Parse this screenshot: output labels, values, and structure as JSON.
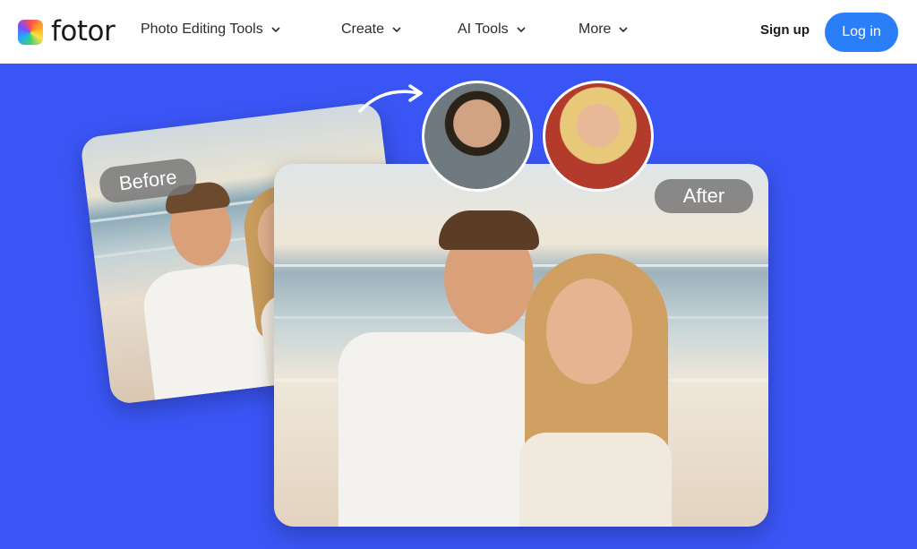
{
  "brand": {
    "name": "fotor"
  },
  "nav": {
    "items": [
      {
        "label": "Photo Editing Tools"
      },
      {
        "label": "Create"
      },
      {
        "label": "AI Tools"
      },
      {
        "label": "More"
      }
    ],
    "signup": "Sign up",
    "login": "Log in"
  },
  "hero": {
    "before_label": "Before",
    "after_label": "After"
  },
  "colors": {
    "hero_bg": "#3a55f5",
    "login_bg": "#2a7ef7",
    "nav_bg": "#ffffff"
  },
  "icons": [
    "fotor-logo-icon",
    "chevron-down-icon",
    "curved-arrow-icon"
  ]
}
